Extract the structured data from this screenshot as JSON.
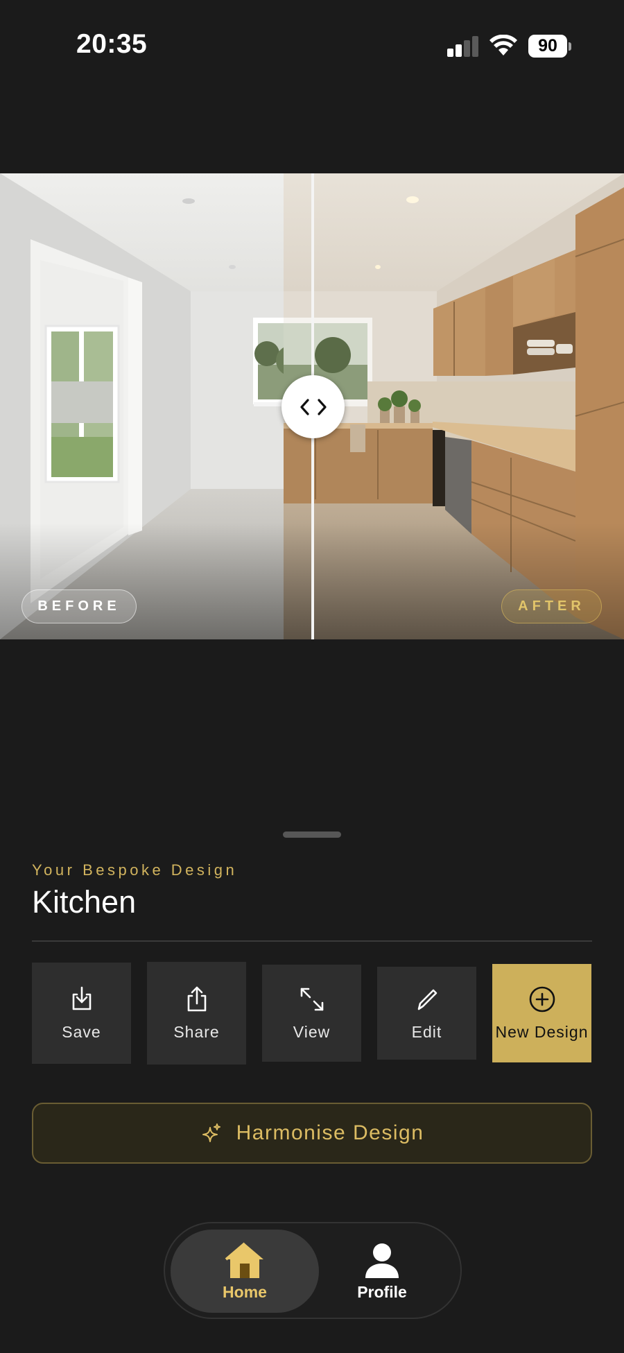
{
  "status_bar": {
    "time": "20:35",
    "battery": "90"
  },
  "comparison": {
    "before_label": "BEFORE",
    "after_label": "AFTER"
  },
  "design": {
    "eyebrow": "Your Bespoke Design",
    "room": "Kitchen"
  },
  "actions": [
    {
      "label": "Save",
      "icon": "download-icon"
    },
    {
      "label": "Share",
      "icon": "share-icon"
    },
    {
      "label": "View",
      "icon": "expand-icon"
    },
    {
      "label": "Edit",
      "icon": "pencil-icon"
    },
    {
      "label": "New Design",
      "icon": "plus-circle-icon"
    }
  ],
  "harmonise": {
    "label": "Harmonise Design",
    "icon": "sparkle-icon"
  },
  "tabs": [
    {
      "label": "Home",
      "icon": "home-icon",
      "active": true
    },
    {
      "label": "Profile",
      "icon": "profile-icon",
      "active": false
    }
  ],
  "colors": {
    "accent": "#cdb05b",
    "background": "#1b1b1b",
    "tile": "#2e2e2e"
  }
}
